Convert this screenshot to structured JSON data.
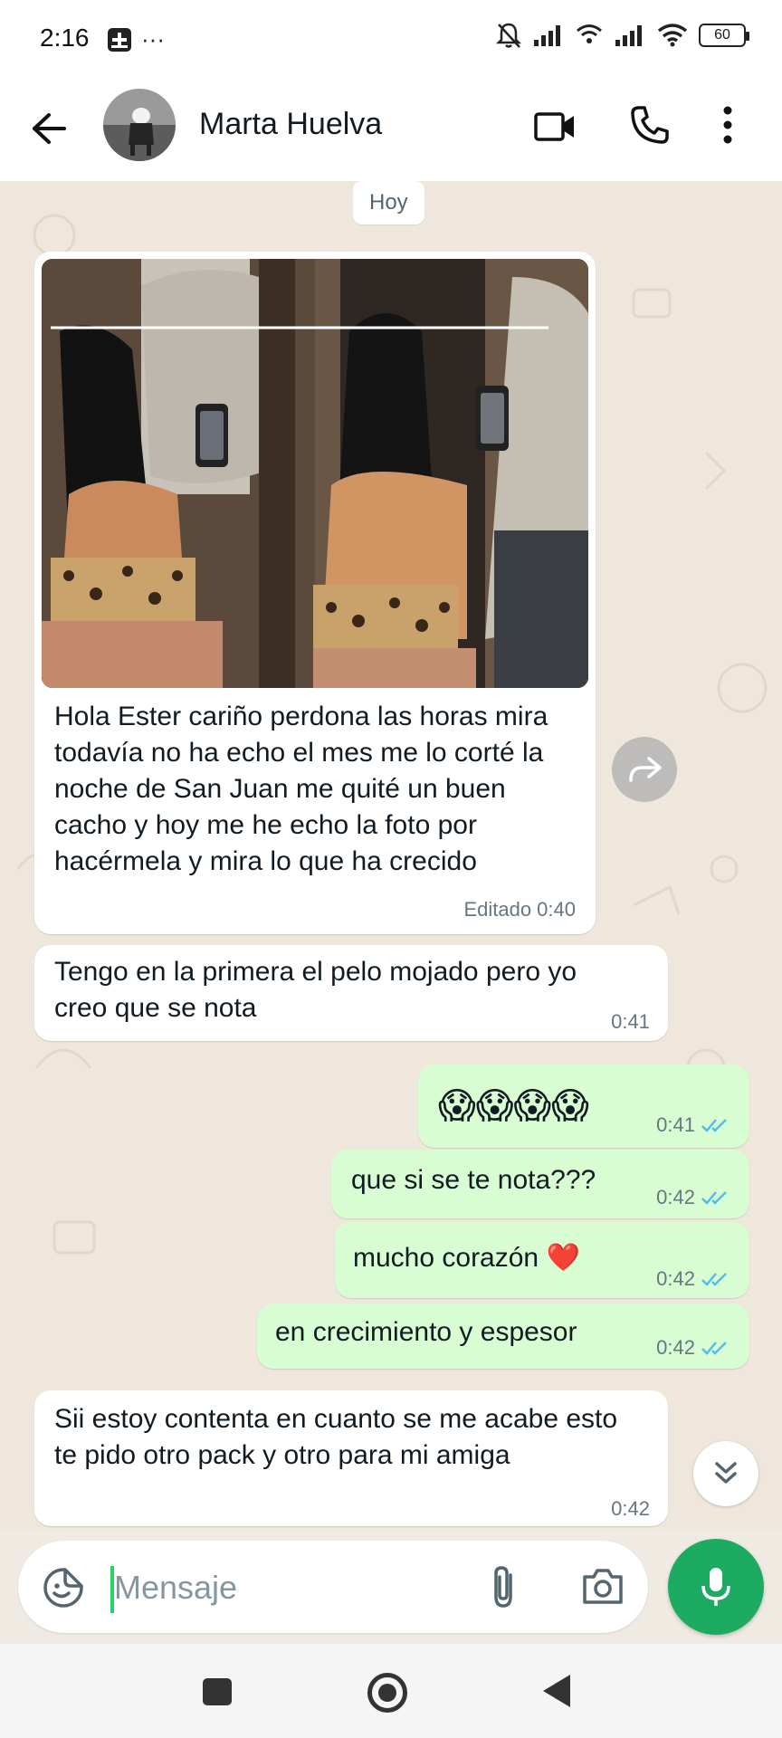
{
  "status_bar": {
    "time": "2:16",
    "dots": "···",
    "battery": "60"
  },
  "header": {
    "contact_name": "Marta Huelva"
  },
  "chat": {
    "day_label": "Hoy",
    "messages": [
      {
        "direction": "in",
        "has_photo": true,
        "text": "Hola Ester cariño perdona las horas mira todavía no ha echo el mes me lo corté la noche de San Juan me quité un buen cacho y hoy me he echo la foto por hacérmela y mira lo que ha crecido",
        "time": "Editado 0:40"
      },
      {
        "direction": "in",
        "text": "Tengo en la primera el pelo mojado pero yo creo que se nota",
        "time": "0:41"
      },
      {
        "direction": "out",
        "text": "😱😱😱😱",
        "time": "0:41",
        "read": true
      },
      {
        "direction": "out",
        "text": "que si se te nota???",
        "time": "0:42",
        "read": true
      },
      {
        "direction": "out",
        "text": "mucho corazón ❤️",
        "time": "0:42",
        "read": true
      },
      {
        "direction": "out",
        "text": "en crecimiento y espesor",
        "time": "0:42",
        "read": true
      },
      {
        "direction": "in",
        "text": "Sii estoy contenta en cuanto se me acabe esto te pido otro pack y otro para mi amiga",
        "time": "0:42"
      }
    ]
  },
  "composer": {
    "placeholder": "Mensaje"
  },
  "colors": {
    "incoming_bubble": "#ffffff",
    "outgoing_bubble": "#d9fdd3",
    "read_ticks": "#53bdeb",
    "mic_button": "#1daa61",
    "chat_background": "#efe7dc"
  },
  "icons": {
    "back": "arrow-left-icon",
    "video": "video-camera-icon",
    "call": "phone-icon",
    "menu": "more-vertical-icon",
    "forward": "forward-icon",
    "scroll_down": "double-chevron-down-icon",
    "sticker": "sticker-icon",
    "attach": "paperclip-icon",
    "camera": "camera-icon",
    "mic": "microphone-icon"
  }
}
